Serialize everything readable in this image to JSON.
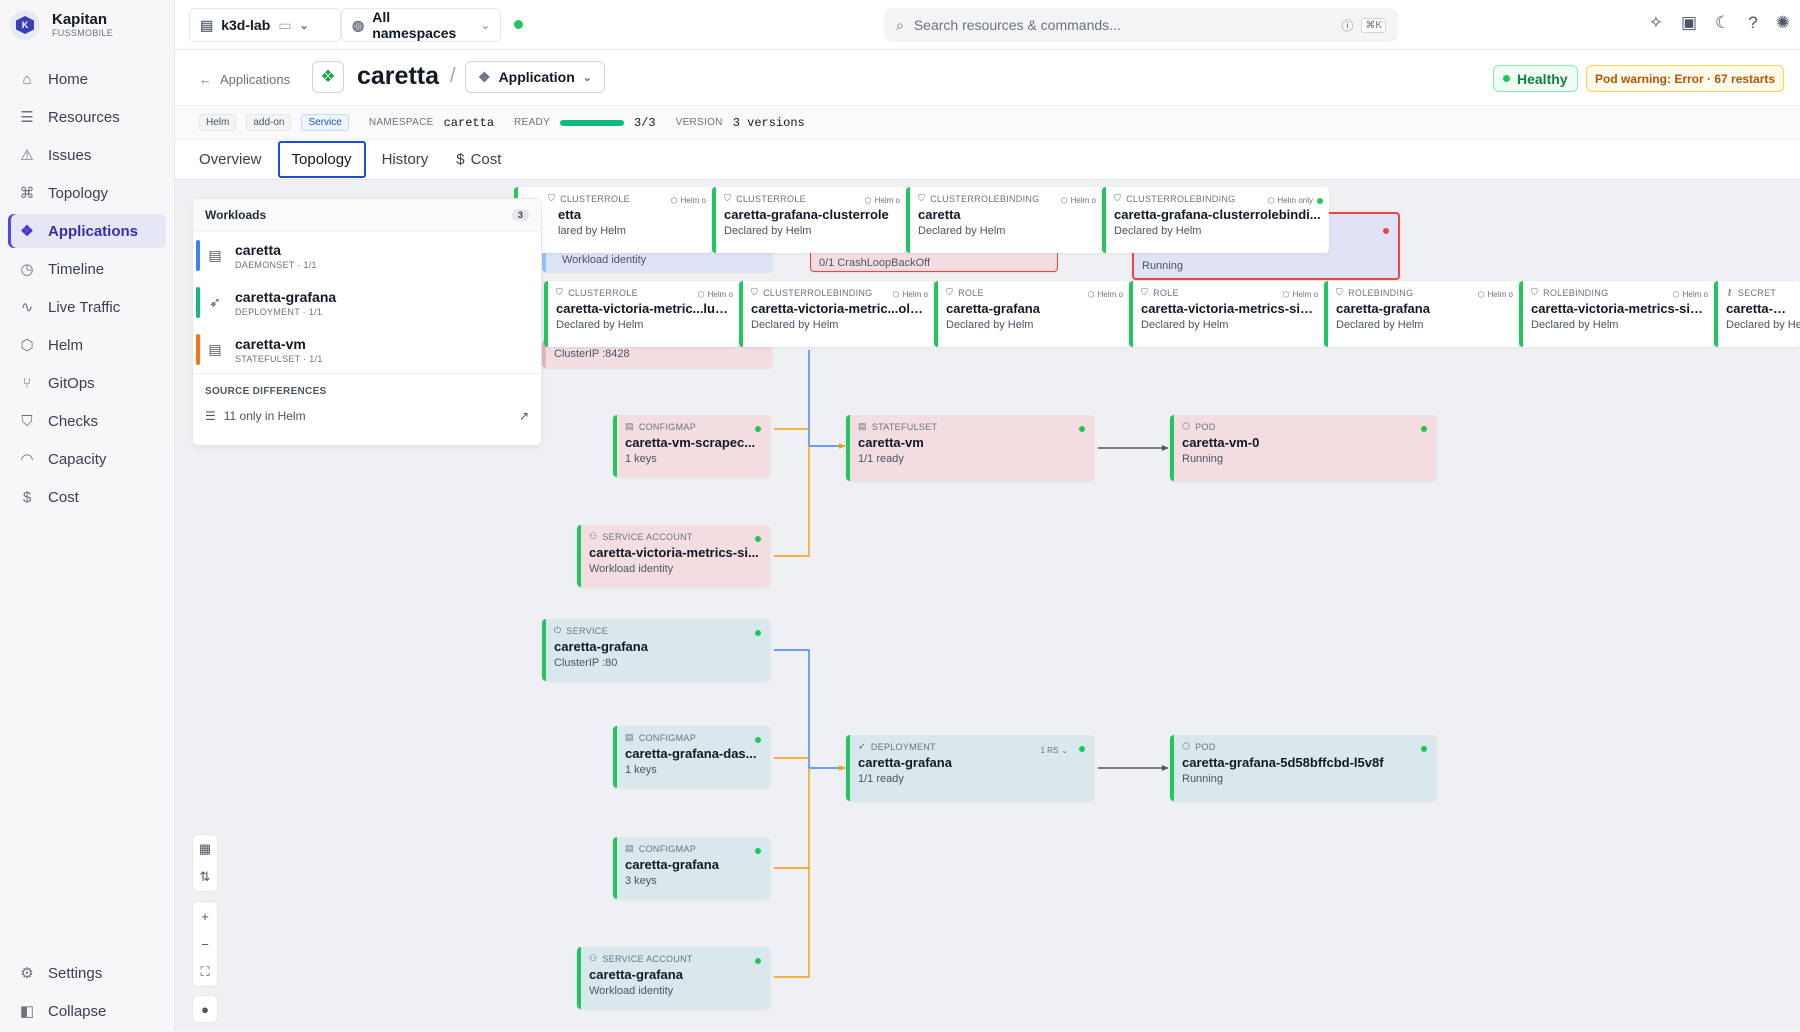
{
  "brand": {
    "name": "Kapitan",
    "sub": "FUSSMOBILE",
    "logo_letter": "K"
  },
  "nav": {
    "items": [
      {
        "label": "Home",
        "icon": "home-icon",
        "glyph": "⌂"
      },
      {
        "label": "Resources",
        "icon": "list-icon",
        "glyph": "☰"
      },
      {
        "label": "Issues",
        "icon": "warning-icon",
        "glyph": "⚠"
      },
      {
        "label": "Topology",
        "icon": "topology-icon",
        "glyph": "⌘"
      },
      {
        "label": "Applications",
        "icon": "applications-icon",
        "glyph": "❖"
      },
      {
        "label": "Timeline",
        "icon": "clock-icon",
        "glyph": "◷"
      },
      {
        "label": "Live Traffic",
        "icon": "pulse-icon",
        "glyph": "∿"
      },
      {
        "label": "Helm",
        "icon": "helm-icon",
        "glyph": "⬡"
      },
      {
        "label": "GitOps",
        "icon": "git-icon",
        "glyph": "⑂"
      },
      {
        "label": "Checks",
        "icon": "shield-check-icon",
        "glyph": "⛉"
      },
      {
        "label": "Capacity",
        "icon": "gauge-icon",
        "glyph": "◠"
      },
      {
        "label": "Cost",
        "icon": "dollar-icon",
        "glyph": "$"
      }
    ],
    "active_index": 4,
    "settings": "Settings",
    "collapse": "Collapse"
  },
  "topbar": {
    "cluster": "k3d-lab",
    "namespace": "All namespaces",
    "search_placeholder": "Search resources & commands...",
    "shortcut": "⌘K"
  },
  "header": {
    "back": "Applications",
    "title": "caretta",
    "kind": "Application",
    "health": "Healthy",
    "warning": "Pod warning: Error · 67 restarts"
  },
  "meta": {
    "tags": [
      "Helm",
      "add-on",
      "Service"
    ],
    "namespace_label": "NAMESPACE",
    "namespace": "caretta",
    "ready_label": "READY",
    "ready": "3/3",
    "ready_fraction": 1,
    "version_label": "VERSION",
    "version": "3 versions"
  },
  "tabs": [
    "Overview",
    "Topology",
    "History",
    "Cost"
  ],
  "workloads": {
    "title": "Workloads",
    "count": "3",
    "items": [
      {
        "name": "caretta",
        "sub": "DAEMONSET · 1/1",
        "color": "#3b82f6"
      },
      {
        "name": "caretta-grafana",
        "sub": "DEPLOYMENT · 1/1",
        "color": "#10b981"
      },
      {
        "name": "caretta-vm",
        "sub": "STATEFULSET · 1/1",
        "color": "#f97316"
      }
    ],
    "source_diff_title": "SOURCE DIFFERENCES",
    "source_diff": "11 only in Helm"
  },
  "nodes": {
    "cr1": {
      "kind": "CLUSTERROLE",
      "name": "etta",
      "sub": "lared by Helm",
      "helm": "Helm o"
    },
    "cr2": {
      "kind": "CLUSTERROLE",
      "name": "caretta-grafana-clusterrole",
      "sub": "Declared by Helm",
      "helm": "Helm o"
    },
    "crb1": {
      "kind": "CLUSTERROLEBINDING",
      "name": "caretta",
      "sub": "Declared by Helm",
      "helm": "Helm o"
    },
    "crb2": {
      "kind": "CLUSTERROLEBINDING",
      "name": "caretta-grafana-clusterrolebindi...",
      "sub": "Declared by Helm",
      "helm": "Helm only"
    },
    "under1": {
      "sub": "Workload identity"
    },
    "under2": {
      "sub": "0/1 CrashLoopBackOff"
    },
    "under3": {
      "sub": "Running"
    },
    "r2a": {
      "kind": "CLUSTERROLE",
      "name": "caretta-victoria-metric...lusterr",
      "sub": "Declared by Helm",
      "helm": "Helm o"
    },
    "r2b": {
      "kind": "CLUSTERROLEBINDING",
      "name": "caretta-victoria-metric...olebinc",
      "sub": "Declared by Helm",
      "helm": "Helm o"
    },
    "r2c": {
      "kind": "ROLE",
      "name": "caretta-grafana",
      "sub": "Declared by Helm",
      "helm": "Helm o"
    },
    "r2d": {
      "kind": "ROLE",
      "name": "caretta-victoria-metrics-single",
      "sub": "Declared by Helm",
      "helm": "Helm o"
    },
    "r2e": {
      "kind": "ROLEBINDING",
      "name": "caretta-grafana",
      "sub": "Declared by Helm",
      "helm": "Helm o"
    },
    "r2f": {
      "kind": "ROLEBINDING",
      "name": "caretta-victoria-metrics-single",
      "sub": "Declared by Helm",
      "helm": "Helm o"
    },
    "r2g": {
      "kind": "SECRET",
      "name": "caretta-grafa",
      "sub": "Declared by Hel"
    },
    "clusterip": {
      "sub": "ClusterIP :8428"
    },
    "cm_vm": {
      "kind": "CONFIGMAP",
      "name": "caretta-vm-scrapec...",
      "sub": "1 keys"
    },
    "sts_vm": {
      "kind": "STATEFULSET",
      "name": "caretta-vm",
      "sub": "1/1 ready"
    },
    "pod_vm": {
      "kind": "POD",
      "name": "caretta-vm-0",
      "sub": "Running"
    },
    "sa_vm": {
      "kind": "SERVICE ACCOUNT",
      "name": "caretta-victoria-metrics-si...",
      "sub": "Workload identity"
    },
    "svc_gr": {
      "kind": "SERVICE",
      "name": "caretta-grafana",
      "sub": "ClusterIP :80"
    },
    "cm_gr_das": {
      "kind": "CONFIGMAP",
      "name": "caretta-grafana-das...",
      "sub": "1 keys"
    },
    "dep_gr": {
      "kind": "DEPLOYMENT",
      "name": "caretta-grafana",
      "sub": "1/1 ready",
      "rs": "1 RS"
    },
    "pod_gr": {
      "kind": "POD",
      "name": "caretta-grafana-5d58bffcbd-l5v8f",
      "sub": "Running"
    },
    "cm_gr": {
      "kind": "CONFIGMAP",
      "name": "caretta-grafana",
      "sub": "3 keys"
    },
    "sa_gr": {
      "kind": "SERVICE ACCOUNT",
      "name": "caretta-grafana",
      "sub": "Workload identity"
    }
  }
}
